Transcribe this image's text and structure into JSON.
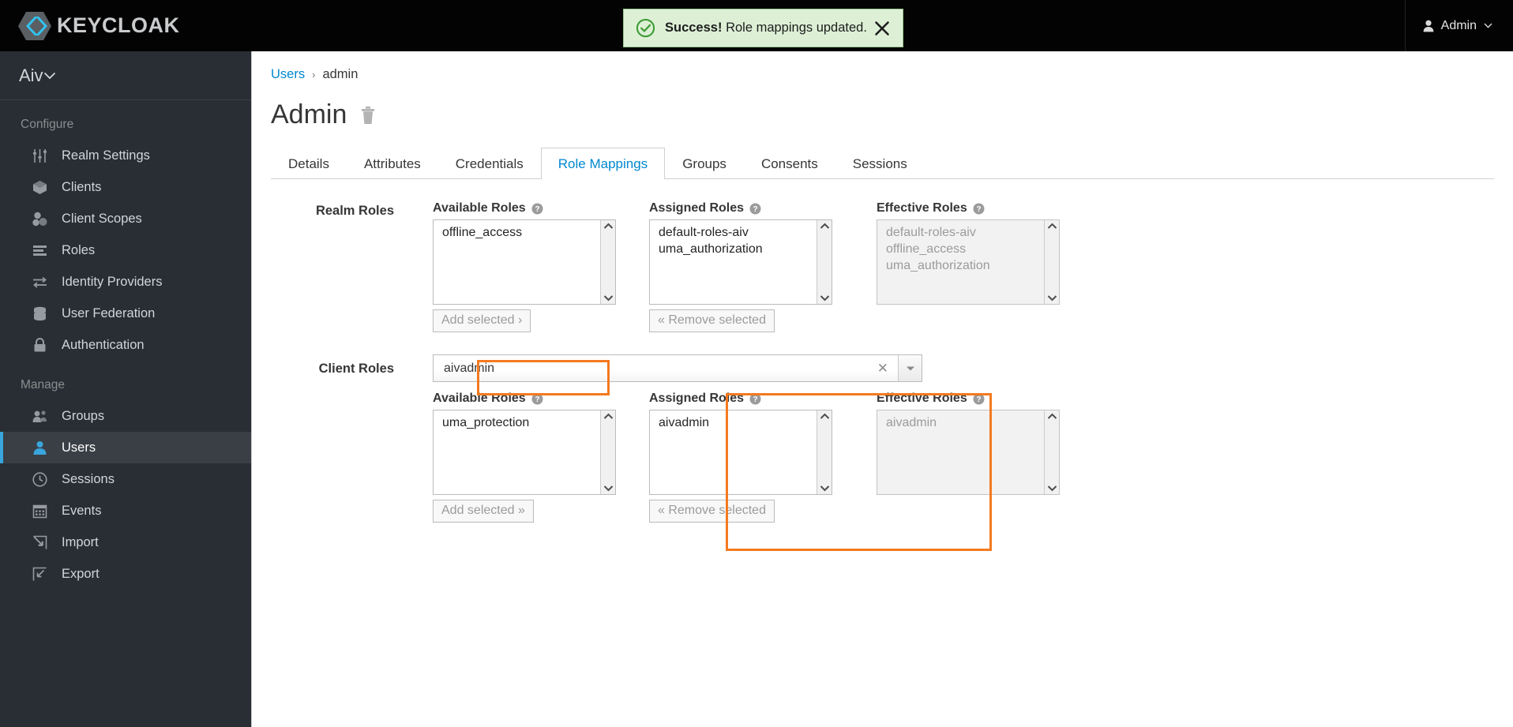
{
  "masthead": {
    "brand_text": "KEYCLOAK",
    "user_name": "Admin"
  },
  "alert": {
    "prefix": "Success!",
    "message": "Role mappings updated."
  },
  "sidebar": {
    "realm_name": "Aiv",
    "groups": [
      {
        "title": "Configure",
        "items": [
          {
            "label": "Realm Settings",
            "icon": "sliders-icon",
            "active": false
          },
          {
            "label": "Clients",
            "icon": "cube-icon",
            "active": false
          },
          {
            "label": "Client Scopes",
            "icon": "blocks-icon",
            "active": false
          },
          {
            "label": "Roles",
            "icon": "list-stripes-icon",
            "active": false
          },
          {
            "label": "Identity Providers",
            "icon": "exchange-arrows-icon",
            "active": false
          },
          {
            "label": "User Federation",
            "icon": "database-icon",
            "active": false
          },
          {
            "label": "Authentication",
            "icon": "lock-icon",
            "active": false
          }
        ]
      },
      {
        "title": "Manage",
        "items": [
          {
            "label": "Groups",
            "icon": "users-icon",
            "active": false
          },
          {
            "label": "Users",
            "icon": "user-icon",
            "active": true
          },
          {
            "label": "Sessions",
            "icon": "clock-icon",
            "active": false
          },
          {
            "label": "Events",
            "icon": "calendar-icon",
            "active": false
          },
          {
            "label": "Import",
            "icon": "import-arrow-icon",
            "active": false
          },
          {
            "label": "Export",
            "icon": "export-arrow-icon",
            "active": false
          }
        ]
      }
    ]
  },
  "breadcrumb": {
    "parent": "Users",
    "separator": "›",
    "current": "admin"
  },
  "page": {
    "title": "Admin"
  },
  "tabs": [
    {
      "label": "Details",
      "active": false
    },
    {
      "label": "Attributes",
      "active": false
    },
    {
      "label": "Credentials",
      "active": false
    },
    {
      "label": "Role Mappings",
      "active": true
    },
    {
      "label": "Groups",
      "active": false
    },
    {
      "label": "Consents",
      "active": false
    },
    {
      "label": "Sessions",
      "active": false
    }
  ],
  "realm_roles": {
    "row_label": "Realm Roles",
    "available": {
      "label": "Available Roles",
      "items": [
        "offline_access"
      ],
      "button": "Add selected ›"
    },
    "assigned": {
      "label": "Assigned Roles",
      "items": [
        "default-roles-aiv",
        "uma_authorization"
      ],
      "button": "« Remove selected"
    },
    "effective": {
      "label": "Effective Roles",
      "items": [
        "default-roles-aiv",
        "offline_access",
        "uma_authorization"
      ]
    }
  },
  "client_roles": {
    "row_label": "Client Roles",
    "select": {
      "value": "aivadmin",
      "clear": "✕"
    },
    "available": {
      "label": "Available Roles",
      "items": [
        "uma_protection"
      ],
      "button": "Add selected »"
    },
    "assigned": {
      "label": "Assigned Roles",
      "items": [
        "aivadmin"
      ],
      "button": "« Remove selected"
    },
    "effective": {
      "label": "Effective Roles",
      "items": [
        "aivadmin"
      ]
    }
  },
  "colors": {
    "accent_blue": "#0088ce",
    "sidebar_bg": "#292e34",
    "active_marker": "#39a5dc",
    "success_bg": "#ddf0d6",
    "success_border": "#9ec88f",
    "success_green": "#3f9c35",
    "annotation_orange": "#f47a20"
  }
}
